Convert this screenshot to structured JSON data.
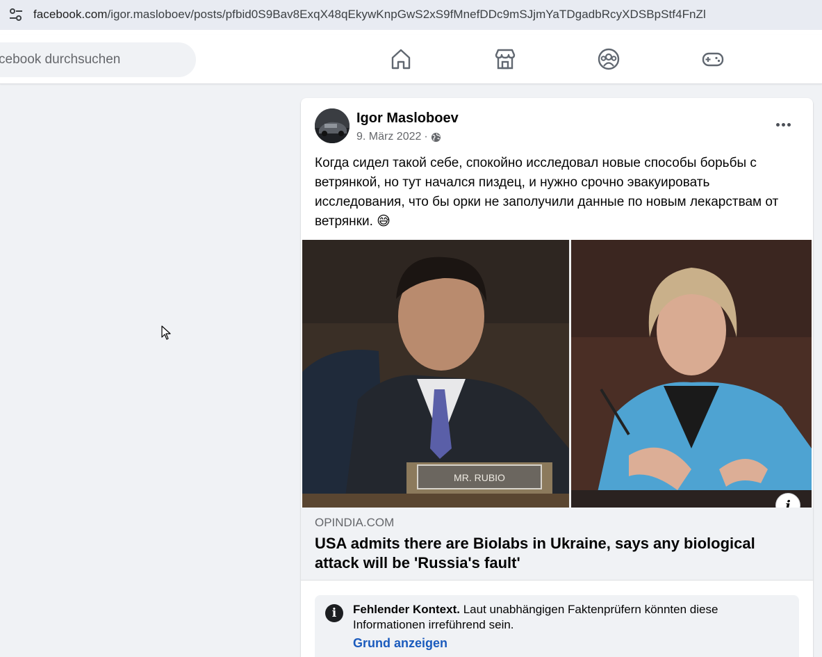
{
  "browser": {
    "url_domain": "facebook.com",
    "url_path": "/igor.masloboev/posts/pfbid0S9Bav8ExqX48qEkywKnpGwS2xS9fMnefDDc9mSJjmYaTDgadbRcyXDSBpStf4FnZl"
  },
  "header": {
    "search_placeholder": "cebook durchsuchen",
    "nav_icons": [
      "home-icon",
      "marketplace-icon",
      "groups-icon",
      "gaming-icon"
    ]
  },
  "post": {
    "author": "Igor Masloboev",
    "date": "9. März 2022",
    "separator": "·",
    "audience_icon": "globe-icon",
    "text": "Когда сидел такой себе, спокойно исследовал новые способы борьбы с ветрянкой, но тут начался пиздец, и нужно срочно эвакуировать исследования, что бы орки не заполучили данные по новым лекарствам от ветрянки. 😅",
    "image": {
      "nameplate": "MR. RUBIO"
    },
    "link": {
      "domain": "OPINDIA.COM",
      "headline": "USA admits there are Biolabs in Ukraine, says any biological attack will be 'Russia's fault'"
    },
    "fact_check": {
      "label": "Fehlender Kontext.",
      "text": "Laut unabhängigen Faktenprüfern könnten diese Informationen irreführend sein.",
      "action": "Grund anzeigen"
    }
  },
  "colors": {
    "link_blue": "#1b5bbd",
    "background": "#f0f2f5",
    "secondary_text": "#65676b"
  }
}
